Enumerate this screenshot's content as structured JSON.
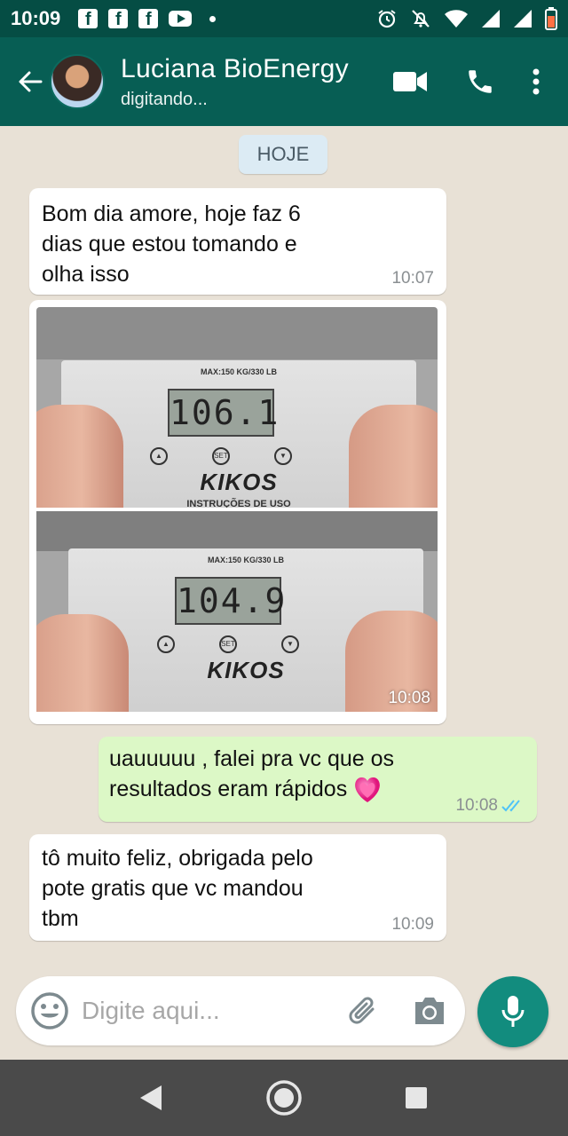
{
  "status_bar": {
    "time": "10:09",
    "notification_icons": [
      "facebook-icon",
      "facebook-icon",
      "facebook-icon",
      "youtube-icon",
      "dot-icon"
    ],
    "system_icons": [
      "alarm-icon",
      "mute-icon",
      "wifi-icon",
      "signal-icon",
      "signal-icon",
      "battery-icon"
    ]
  },
  "header": {
    "contact_name": "Luciana BioEnergy",
    "contact_status": "digitando...",
    "actions": [
      "video-call-icon",
      "phone-icon",
      "more-icon"
    ]
  },
  "chat": {
    "date_chip": "HOJE",
    "messages": [
      {
        "direction": "incoming",
        "text": "Bom dia amore, hoje faz 6\ndias que estou tomando e\nolha isso",
        "time": "10:07"
      },
      {
        "direction": "incoming",
        "type": "image",
        "time": "10:08",
        "image": {
          "top": {
            "max_label": "MAX:150 KG/330 LB",
            "display": "106.1",
            "brand": "KIKOS",
            "sub": "INSTRUÇÕES DE USO",
            "buttons": [
              "▲",
              "SET",
              "▼"
            ]
          },
          "bottom": {
            "max_label": "MAX:150 KG/330 LB",
            "display": "104.9",
            "brand": "KIKOS",
            "buttons": [
              "▲",
              "SET",
              "▼"
            ]
          }
        }
      },
      {
        "direction": "outgoing",
        "text": "uauuuuu , falei pra vc que os\nresultados eram rápidos",
        "emoji": "heart-icon",
        "time": "10:08",
        "read_status": "read"
      },
      {
        "direction": "incoming",
        "text": "tô muito feliz, obrigada pelo\npote gratis que vc mandou\ntbm",
        "time": "10:09"
      }
    ]
  },
  "composer": {
    "placeholder": "Digite aqui...",
    "icons": [
      "emoji-icon",
      "attach-icon",
      "camera-icon",
      "mic-icon"
    ]
  },
  "colors": {
    "header": "#075e54",
    "status_bar": "#054d44",
    "outgoing_bubble": "#dcf8c6",
    "incoming_bubble": "#ffffff",
    "mic_button": "#128c7e",
    "read_ticks": "#4fc3f7"
  }
}
